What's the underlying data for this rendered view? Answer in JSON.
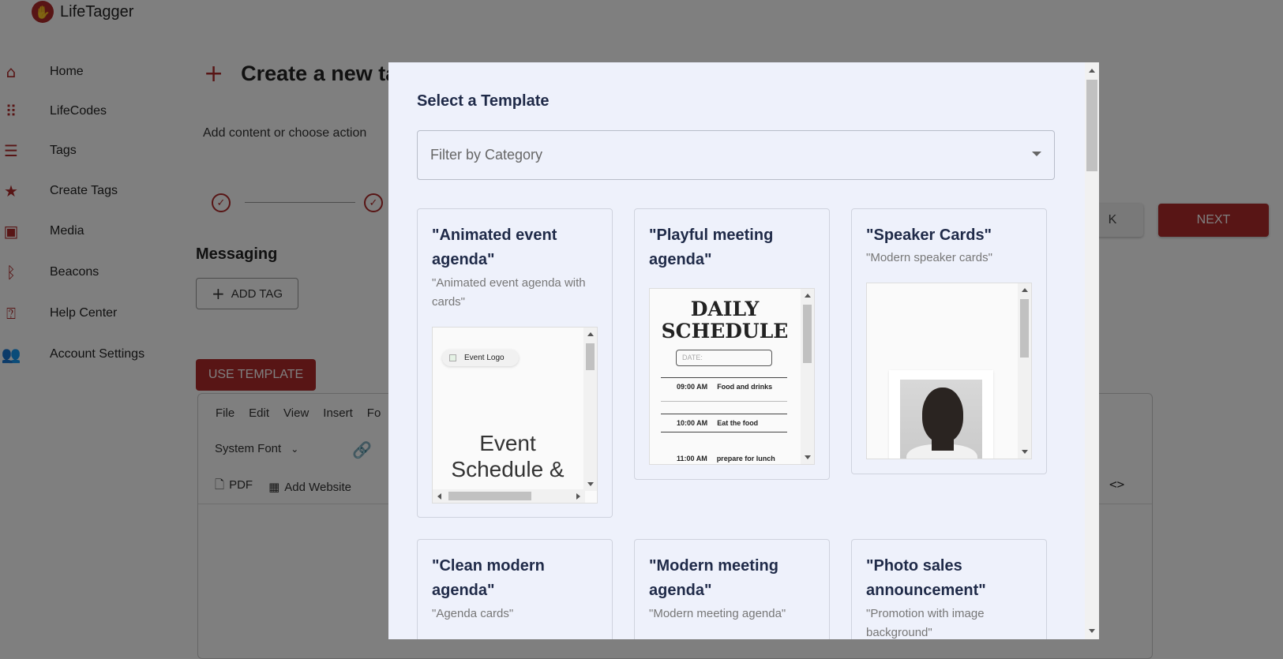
{
  "app": {
    "brand_name": "LifeTagger",
    "brand_color": "#b02a2a"
  },
  "sidebar": {
    "items": [
      {
        "label": "Home",
        "icon": "home-icon"
      },
      {
        "label": "LifeCodes",
        "icon": "grid-dots-icon"
      },
      {
        "label": "Tags",
        "icon": "list-icon"
      },
      {
        "label": "Create Tags",
        "icon": "star-icon"
      },
      {
        "label": "Media",
        "icon": "media-icon"
      },
      {
        "label": "Beacons",
        "icon": "bluetooth-icon"
      },
      {
        "label": "Help Center",
        "icon": "help-icon"
      },
      {
        "label": "Account Settings",
        "icon": "people-icon"
      }
    ]
  },
  "page": {
    "title": "Create a new ta",
    "subtitle": "Add content or choose action",
    "back_label": "K",
    "next_label": "NEXT",
    "section_title": "Messaging",
    "add_tag_label": "ADD TAG",
    "use_template_label": "USE TEMPLATE"
  },
  "editor": {
    "menus": [
      "File",
      "Edit",
      "View",
      "Insert",
      "Fo"
    ],
    "font": "System Font",
    "tools": {
      "pdf": "PDF",
      "website": "Add Website"
    },
    "code_glyph": "<>"
  },
  "modal": {
    "title": "Select a Template",
    "filter_placeholder": "Filter by Category",
    "cards": [
      {
        "title": "\"Animated event agenda\"",
        "desc": "\"Animated event agenda with cards\""
      },
      {
        "title": "\"Playful meeting agenda\"",
        "desc": ""
      },
      {
        "title": "\"Speaker Cards\"",
        "desc": "\"Modern speaker cards\""
      },
      {
        "title": "\"Clean modern agenda\"",
        "desc": "\"Agenda cards\""
      },
      {
        "title": "\"Modern meeting agenda\"",
        "desc": "\"Modern meeting agenda\""
      },
      {
        "title": "\"Photo sales announcement\"",
        "desc": "\"Promotion with image background\""
      }
    ],
    "preview_event": {
      "logo_text": "Event Logo",
      "heading": "Event Schedule &"
    },
    "preview_schedule": {
      "title": "DAILY SCHEDULE",
      "date_placeholder": "DATE:",
      "rows": [
        {
          "time": "09:00 AM",
          "task": "Food and drinks"
        },
        {
          "time": "10:00 AM",
          "task": "Eat the food"
        },
        {
          "time": "11:00 AM",
          "task": "prepare for lunch"
        }
      ]
    }
  }
}
